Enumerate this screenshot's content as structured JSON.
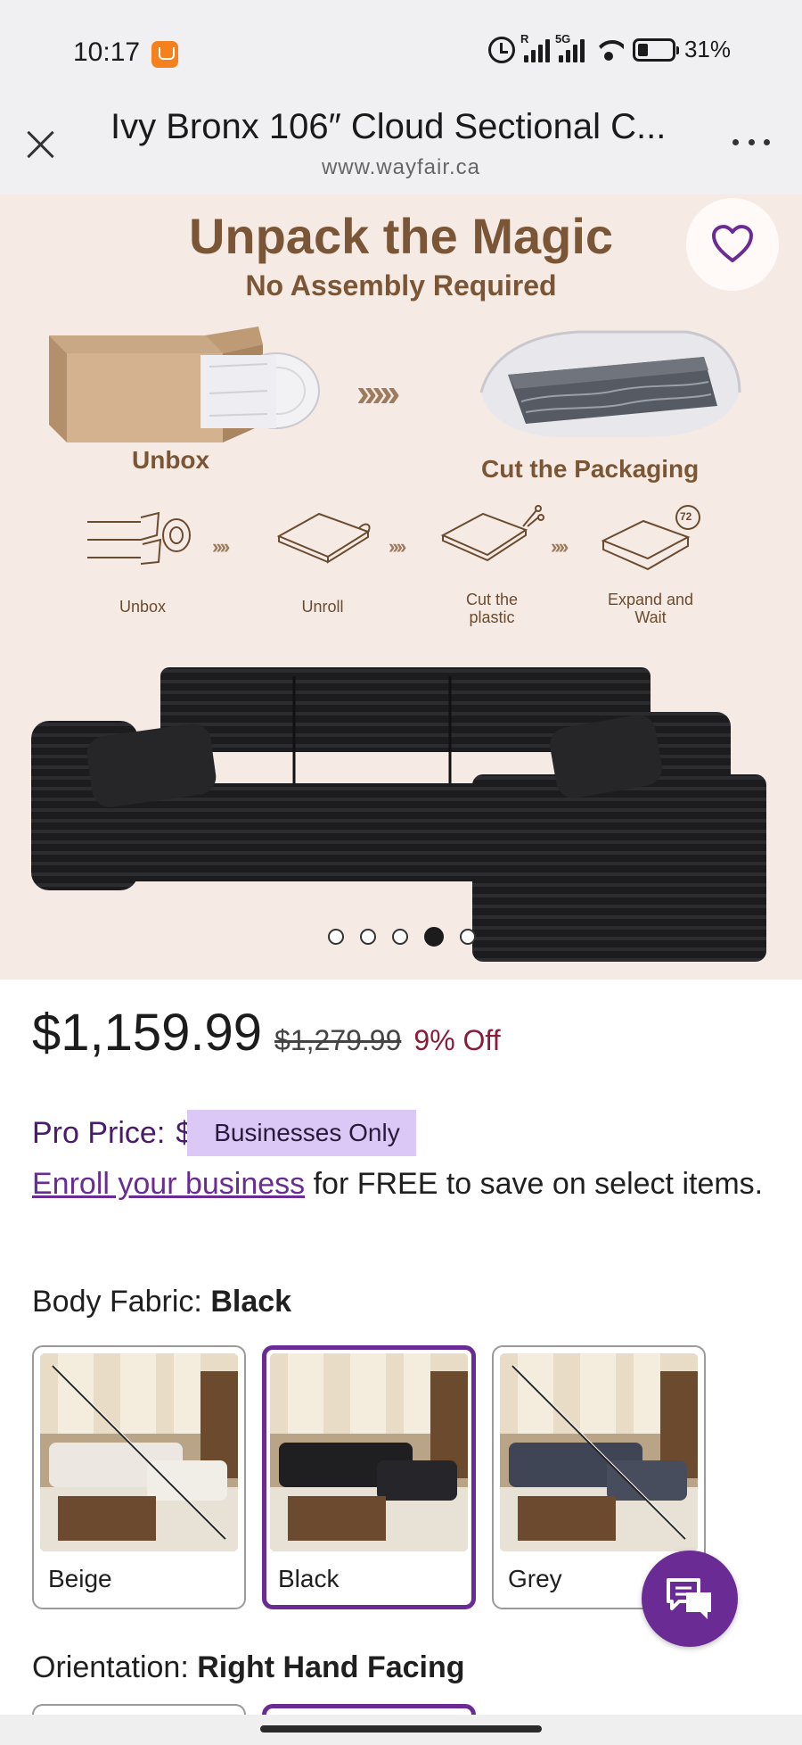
{
  "status_bar": {
    "time": "10:17",
    "network_r": "R",
    "network_5g": "5G",
    "battery_percent": "31%"
  },
  "browser": {
    "title": "Ivy Bronx 106″ Cloud Sectional C...",
    "url": "www.wayfair.ca"
  },
  "hero": {
    "title": "Unpack the Magic",
    "subtitle": "No Assembly Required",
    "big_steps": [
      "Unbox",
      "Cut the Packaging"
    ],
    "small_steps": [
      "Unbox",
      "Unroll",
      "Cut the plastic",
      "Expand and Wait"
    ],
    "timer_label": "72",
    "carousel_total": 5,
    "carousel_active": 4
  },
  "price": {
    "current": "$1,159.99",
    "original": "$1,279.99",
    "discount": "9% Off"
  },
  "pro": {
    "label": "Pro Price:",
    "dollar": "$",
    "badge": "Businesses Only",
    "enroll_link": "Enroll your business",
    "enroll_rest": " for FREE to save on select items."
  },
  "fabric": {
    "label": "Body Fabric: ",
    "selected": "Black",
    "options": [
      {
        "name": "Beige",
        "available": false
      },
      {
        "name": "Black",
        "available": true
      },
      {
        "name": "Grey",
        "available": false
      }
    ]
  },
  "orientation": {
    "label": "Orientation: ",
    "selected": "Right Hand Facing"
  },
  "colors": {
    "accent": "#6b2b94",
    "sale": "#8a1c39",
    "hero_bg": "#f6ebe4",
    "hero_text": "#7a5636"
  }
}
